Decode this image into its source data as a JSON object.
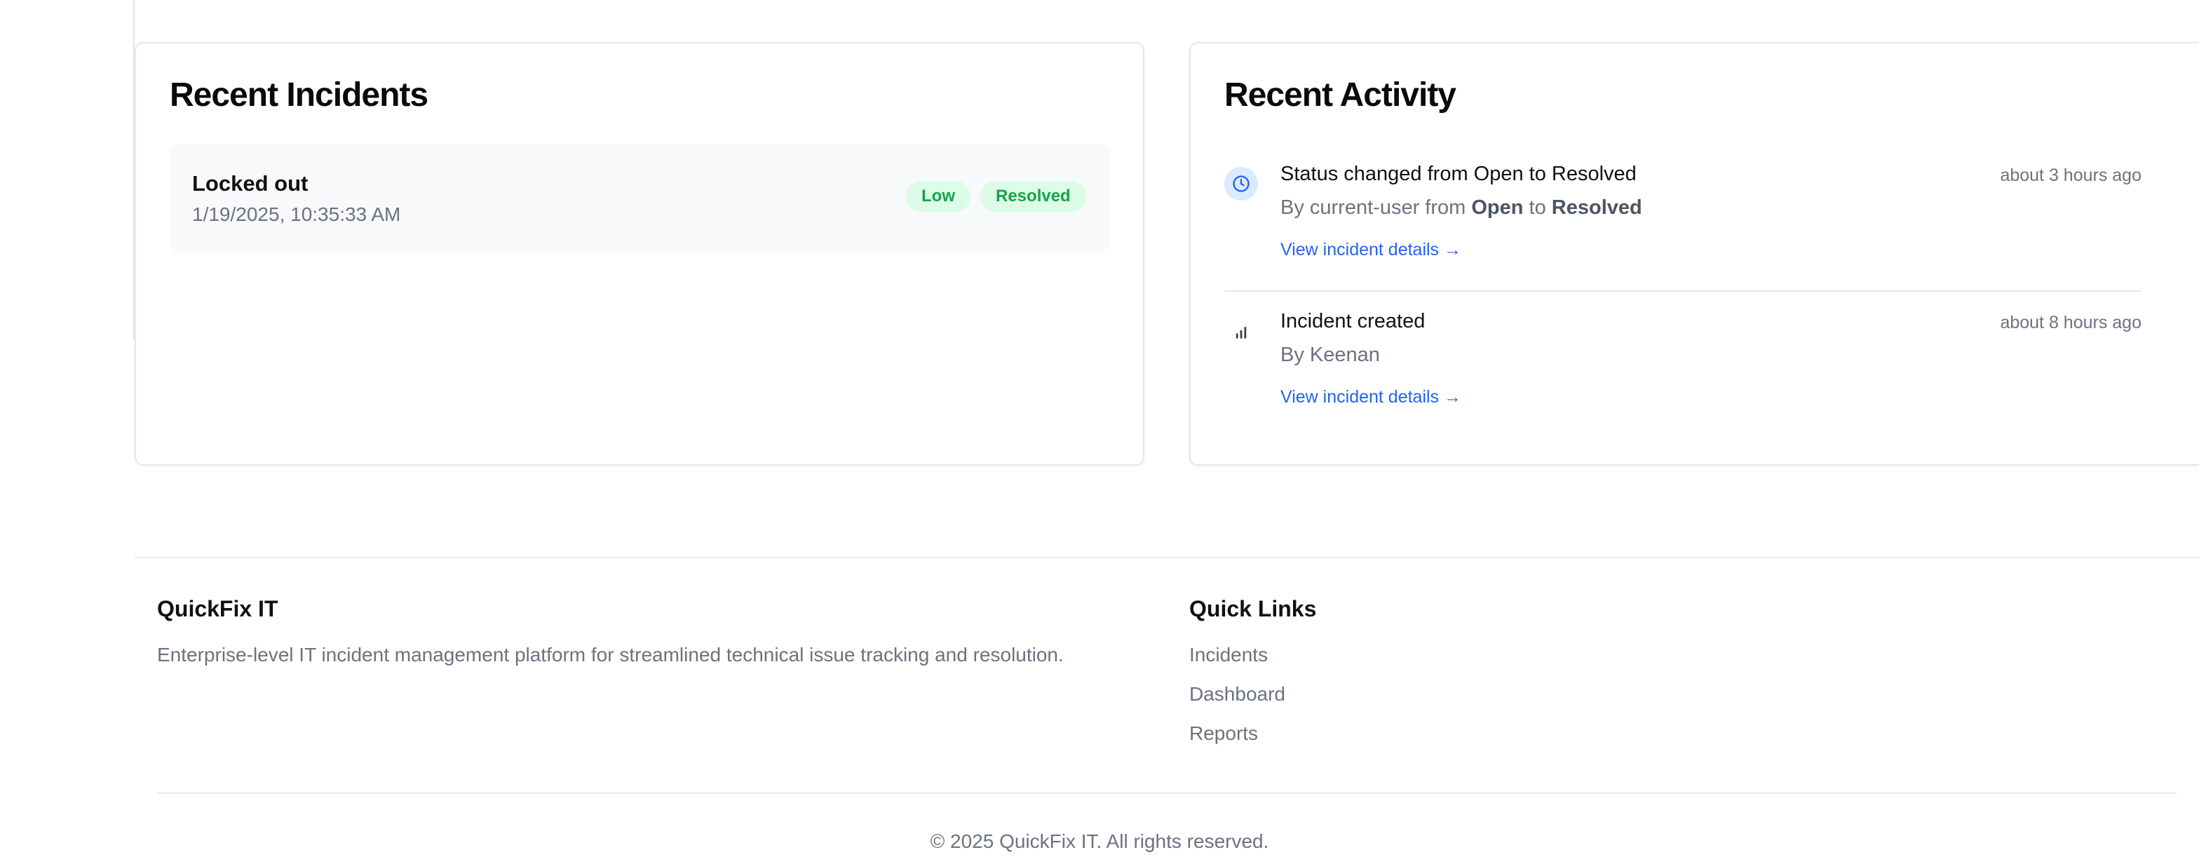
{
  "incidents_card": {
    "title": "Recent Incidents",
    "items": [
      {
        "title": "Locked out",
        "date": "1/19/2025, 10:35:33 AM",
        "priority": "Low",
        "status": "Resolved"
      }
    ]
  },
  "activity_card": {
    "title": "Recent Activity",
    "items": [
      {
        "icon": "clock-icon",
        "title": "Status changed from Open to Resolved",
        "by_prefix": "By current-user from ",
        "from": "Open",
        "to_word": " to ",
        "to": "Resolved",
        "link": "View incident details →",
        "time": "about 3 hours ago"
      },
      {
        "icon": "bar-chart-icon",
        "title": "Incident created",
        "by_prefix": "By Keenan",
        "link": "View incident details →",
        "time": "about 8 hours ago"
      }
    ]
  },
  "footer": {
    "brand": "QuickFix IT",
    "description": "Enterprise-level IT incident management platform for streamlined technical issue tracking and resolution.",
    "links_title": "Quick Links",
    "links": [
      "Incidents",
      "Dashboard",
      "Reports"
    ],
    "copyright": "© 2025 QuickFix IT. All rights reserved."
  },
  "colors": {
    "badge_bg": "#dcfce7",
    "badge_text": "#16a34a",
    "link": "#2563eb",
    "muted": "#6b7280"
  }
}
